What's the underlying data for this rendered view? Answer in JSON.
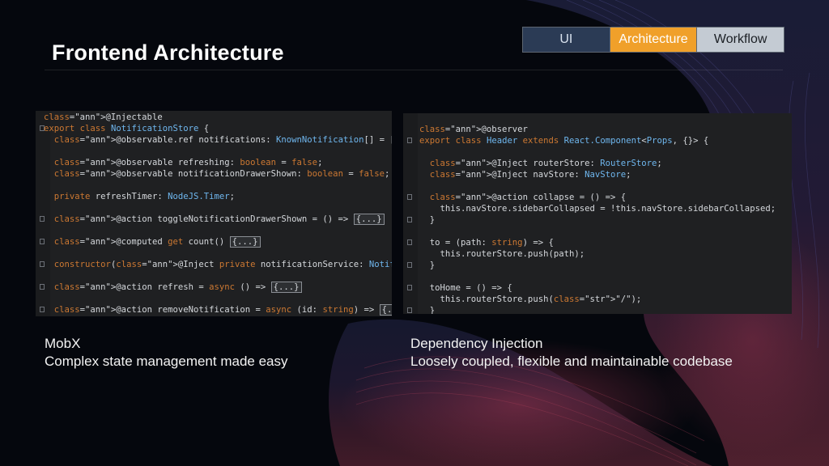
{
  "slide": {
    "title": "Frontend Architecture",
    "tabs": [
      {
        "label": "UI"
      },
      {
        "label": "Architecture",
        "active": true
      },
      {
        "label": "Workflow"
      }
    ]
  },
  "left_panel": {
    "code_lines": [
      "@Injectable",
      "export class NotificationStore {",
      "  @observable.ref notifications: KnownNotification[] = [];",
      "",
      "  @observable refreshing: boolean = false;",
      "  @observable notificationDrawerShown: boolean = false;",
      "",
      "  private refreshTimer: NodeJS.Timer;",
      "",
      "  @action toggleNotificationDrawerShown = () => {...}",
      "",
      "  @computed get count() {...}",
      "",
      "  constructor(@Inject private notificationService: NotificationService) { }",
      "",
      "  @action refresh = async () => {...}",
      "",
      "  @action removeNotification = async (id: string) => {...}"
    ],
    "caption_title": "MobX",
    "caption_text": "Complex state management made easy"
  },
  "right_panel": {
    "code_lines": [
      "@observer",
      "export class Header extends React.Component<Props, {}> {",
      "",
      "  @Inject routerStore: RouterStore;",
      "  @Inject navStore: NavStore;",
      "",
      "  @action collapse = () => {",
      "    this.navStore.sidebarCollapsed = !this.navStore.sidebarCollapsed;",
      "  }",
      "",
      "  to = (path: string) => {",
      "    this.routerStore.push(path);",
      "  }",
      "",
      "  toHome = () => {",
      "    this.routerStore.push(\"/\");",
      "  }"
    ],
    "caption_title": "Dependency Injection",
    "caption_text": "Loosely coupled, flexible and maintainable codebase"
  },
  "colors": {
    "accent": "#f0a02a",
    "tab_ui_bg": "#2b3b55",
    "tab_bg": "#c4cbd3",
    "code_bg": "#1f2022",
    "background": "#05070d"
  }
}
